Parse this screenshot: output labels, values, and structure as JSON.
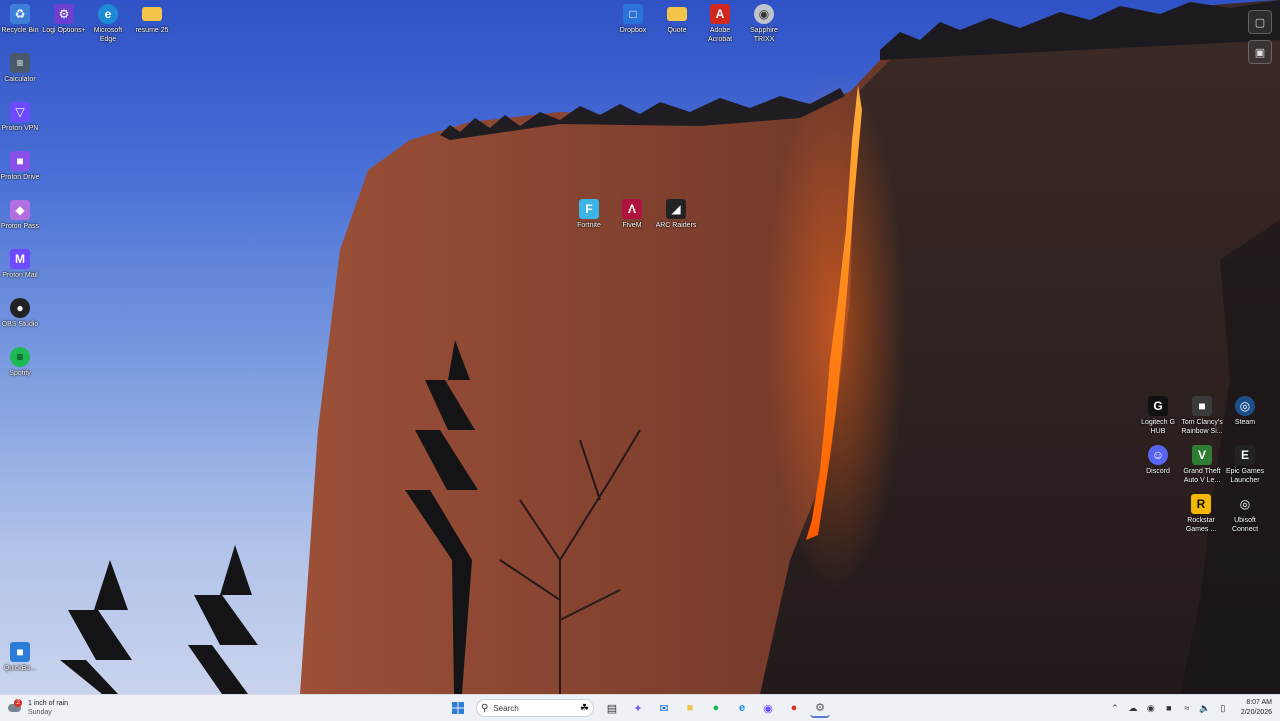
{
  "desktop": {
    "left_icons": [
      {
        "name": "recycle-bin",
        "label": "Recycle Bin",
        "glyph": "♻",
        "color": "#3d7fd6"
      },
      {
        "name": "logi-options",
        "label": "Logi Options+",
        "glyph": "⚙",
        "color": "#6b3fd0"
      },
      {
        "name": "microsoft-edge",
        "label": "Microsoft Edge",
        "glyph": "e",
        "color": "#1c8ad4"
      },
      {
        "name": "resume-folder",
        "label": "resume 25",
        "glyph": "",
        "color": "#f3c54a"
      },
      {
        "name": "calculator",
        "label": "Calculator",
        "glyph": "≡",
        "color": "#4b5a6b"
      },
      {
        "name": "proton-vpn",
        "label": "Proton VPN",
        "glyph": "▽",
        "color": "#6d4aff"
      },
      {
        "name": "proton-drive",
        "label": "Proton Drive",
        "glyph": "■",
        "color": "#8a4fe8"
      },
      {
        "name": "proton-pass",
        "label": "Proton Pass",
        "glyph": "◆",
        "color": "#b06ee0"
      },
      {
        "name": "proton-mail",
        "label": "Proton Mail",
        "glyph": "M",
        "color": "#6d4aff"
      },
      {
        "name": "obs-studio",
        "label": "OBS Studio",
        "glyph": "●",
        "color": "#222"
      },
      {
        "name": "spotify",
        "label": "Spotify",
        "glyph": "≡",
        "color": "#1db954"
      },
      {
        "name": "quickbooks",
        "label": "QuickBo...",
        "glyph": "■",
        "color": "#2a7cd6"
      }
    ],
    "top_icons": [
      {
        "name": "dropbox",
        "label": "Dropbox",
        "glyph": "□",
        "color": "#2b72d8"
      },
      {
        "name": "quote-folder",
        "label": "Quote",
        "glyph": "",
        "color": "#f3c54a"
      },
      {
        "name": "adobe-acrobat",
        "label": "Adobe Acrobat",
        "glyph": "A",
        "color": "#d1281d"
      },
      {
        "name": "sapphire-trixx",
        "label": "Sapphire TRIXX",
        "glyph": "◉",
        "color": "#bfc4cc"
      }
    ],
    "center_icons": [
      {
        "name": "fortnite",
        "label": "Fortnite",
        "glyph": "F",
        "color": "#3cb4e6"
      },
      {
        "name": "fivem",
        "label": "FiveM",
        "glyph": "Λ",
        "color": "#b0123f"
      },
      {
        "name": "arc-raiders",
        "label": "ARC Raiders",
        "glyph": "◢",
        "color": "#222"
      }
    ],
    "right_icons": [
      {
        "name": "logitech-g-hub",
        "label": "Logitech G HUB",
        "glyph": "G",
        "color": "#111"
      },
      {
        "name": "rainbow-six",
        "label": "Tom Clancy's Rainbow Si...",
        "glyph": "■",
        "color": "#3a3a3a"
      },
      {
        "name": "steam",
        "label": "Steam",
        "glyph": "◎",
        "color": "#1b4f8a"
      },
      {
        "name": "discord",
        "label": "Discord",
        "glyph": "☺",
        "color": "#5865f2"
      },
      {
        "name": "gta-v",
        "label": "Grand Theft Auto V Le...",
        "glyph": "V",
        "color": "#2f7d32"
      },
      {
        "name": "epic-games",
        "label": "Epic Games Launcher",
        "glyph": "E",
        "color": "#222"
      },
      {
        "name": "rockstar-games",
        "label": "Rockstar Games ...",
        "glyph": "R",
        "color": "#f5b800"
      },
      {
        "name": "ubisoft-connect",
        "label": "Ubisoft Connect",
        "glyph": "◎",
        "color": "#1a1a1a"
      }
    ]
  },
  "taskbar": {
    "weather": {
      "title": "1 inch of rain",
      "subtitle": "Sunday",
      "badge": "2"
    },
    "search": {
      "placeholder": "Search"
    },
    "apps": [
      {
        "name": "file-explorer",
        "glyph": "▤",
        "color": "#333"
      },
      {
        "name": "copilot",
        "glyph": "✦",
        "color": "#7a5af8"
      },
      {
        "name": "outlook",
        "glyph": "✉",
        "color": "#0a64c8"
      },
      {
        "name": "folder",
        "glyph": "■",
        "color": "#f3c54a"
      },
      {
        "name": "spotify",
        "glyph": "●",
        "color": "#1db954"
      },
      {
        "name": "edge",
        "glyph": "e",
        "color": "#1c8ad4"
      },
      {
        "name": "proton-app",
        "glyph": "◉",
        "color": "#6d4aff"
      },
      {
        "name": "chrome",
        "glyph": "●",
        "color": "#d93025"
      },
      {
        "name": "settings",
        "glyph": "⚙",
        "color": "#555"
      }
    ],
    "clock": {
      "time": "8:07 AM",
      "date": "2/20/2026"
    }
  }
}
